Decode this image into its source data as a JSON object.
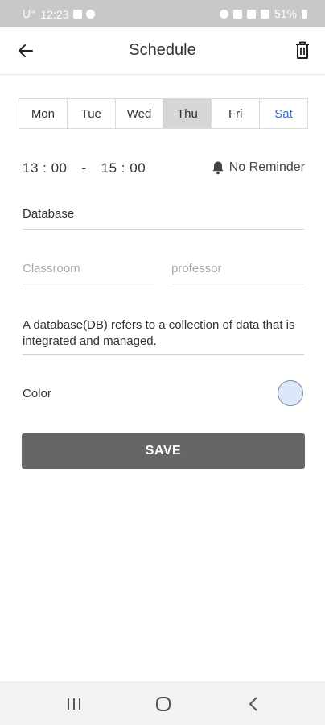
{
  "status_bar": {
    "carrier": "U⁺",
    "time": "12:23",
    "battery": "51%"
  },
  "app_bar": {
    "title": "Schedule"
  },
  "days": [
    {
      "label": "Mon",
      "selected": false
    },
    {
      "label": "Tue",
      "selected": false
    },
    {
      "label": "Wed",
      "selected": false
    },
    {
      "label": "Thu",
      "selected": true
    },
    {
      "label": "Fri",
      "selected": false
    },
    {
      "label": "Sat",
      "selected": false
    }
  ],
  "time": {
    "start": "13 : 00",
    "separator": "-",
    "end": "15 : 00"
  },
  "reminder": {
    "label": "No Reminder"
  },
  "form": {
    "subject_value": "Database",
    "classroom_placeholder": "Classroom",
    "professor_placeholder": "professor",
    "memo_value": "A database(DB) refers to a collection of data that is integrated and managed."
  },
  "color": {
    "label": "Color",
    "value": "#dbe8f9"
  },
  "save_label": "SAVE",
  "colors": {
    "status_bar": "#c8c8c8",
    "save_button": "#666666",
    "selected_day": "#d6d6d6",
    "saturday_text": "#2f6bd8"
  }
}
